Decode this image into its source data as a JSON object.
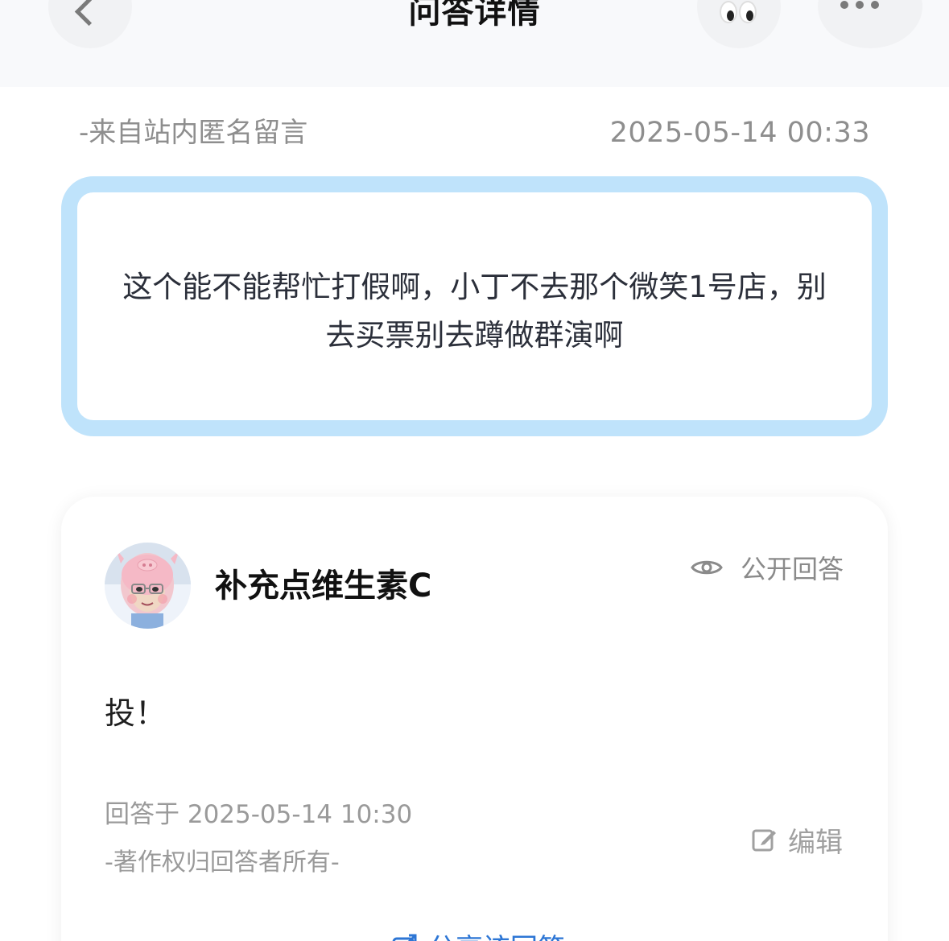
{
  "header": {
    "title": "问答详情"
  },
  "question": {
    "source": "-来自站内匿名留言",
    "datetime": "2025-05-14 00:33",
    "text": "这个能不能帮忙打假啊，小丁不去那个微笑1号店，别去买票别去蹲做群演啊"
  },
  "answer": {
    "author": "补充点维生素C",
    "visibility": "公开回答",
    "text": "投！",
    "answered_at": "回答于 2025-05-14 10:30",
    "copyright": "-著作权归回答者所有-",
    "edit_label": "编辑",
    "share_label": "分享该回答"
  },
  "colors": {
    "accent_blue": "#2d76d5",
    "card_border": "#bfe3fb"
  }
}
